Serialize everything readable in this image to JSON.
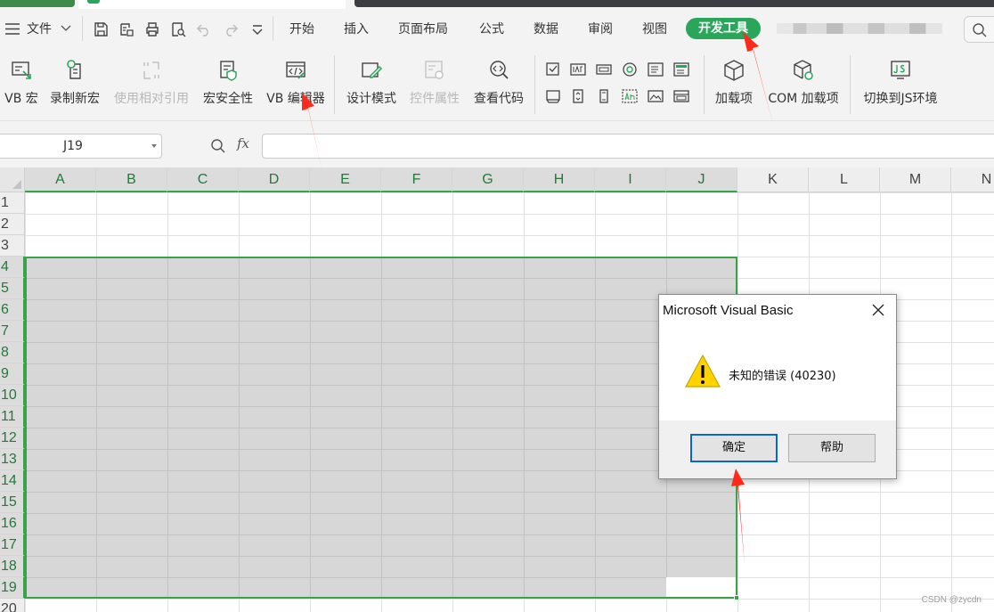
{
  "menu": {
    "file": "文件",
    "tabs": [
      "开始",
      "插入",
      "页面布局",
      "公式",
      "数据",
      "审阅",
      "视图"
    ],
    "dev_tab": "开发工具"
  },
  "ribbon": {
    "vb_macro": "VB 宏",
    "record_macro": "录制新宏",
    "relative_ref": "使用相对引用",
    "macro_security": "宏安全性",
    "vb_editor": "VB 编辑器",
    "design_mode": "设计模式",
    "control_props": "控件属性",
    "view_code": "查看代码",
    "addins": "加载项",
    "com_addins": "COM 加载项",
    "switch_js": "切换到JS环境"
  },
  "formula_bar": {
    "name_box": "J19",
    "fx": "fx"
  },
  "columns": [
    "A",
    "B",
    "C",
    "D",
    "E",
    "F",
    "G",
    "H",
    "I",
    "J",
    "K",
    "L",
    "M",
    "N"
  ],
  "rows": [
    "1",
    "2",
    "3",
    "4",
    "5",
    "6",
    "7",
    "8",
    "9",
    "10",
    "11",
    "12",
    "13",
    "14",
    "15",
    "16",
    "17",
    "18",
    "19",
    "20"
  ],
  "dialog": {
    "title": "Microsoft Visual Basic",
    "message": "未知的错误 (40230)",
    "ok_label": "确定",
    "help_label": "帮助"
  },
  "watermark": "CSDN @zycdn",
  "colors": {
    "accent_green": "#2aa65a",
    "selection_border": "#3aa24a",
    "annotation_red": "#ff2a1a"
  }
}
